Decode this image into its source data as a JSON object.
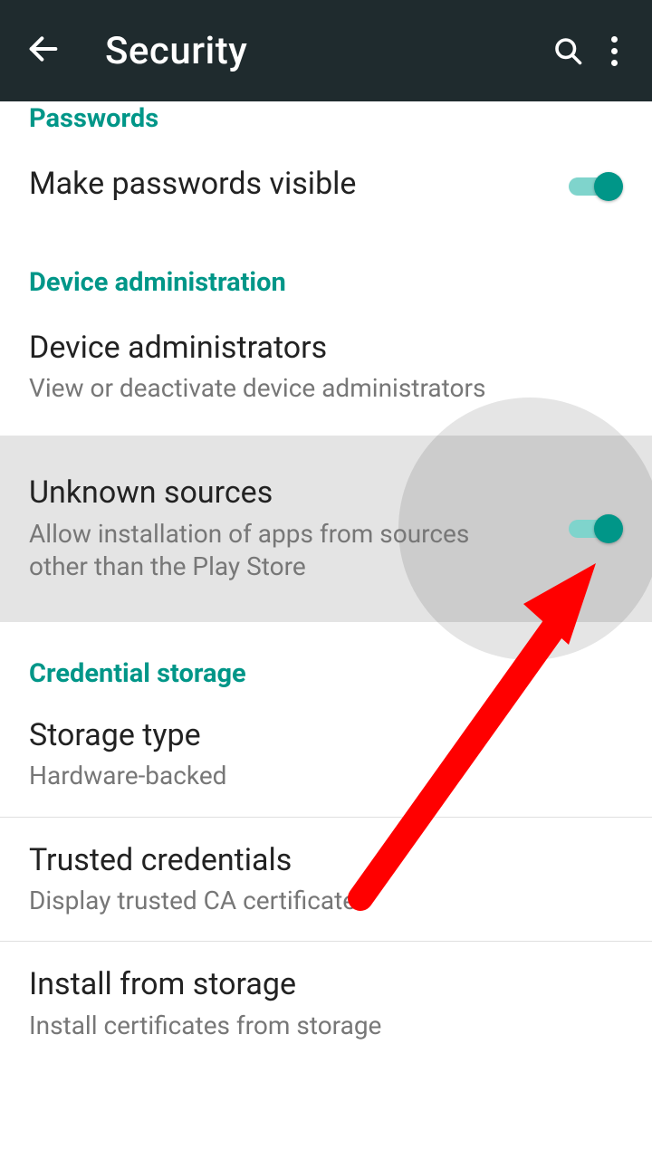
{
  "header": {
    "title": "Security"
  },
  "sections": {
    "passwords_header": "Passwords",
    "make_passwords_visible": "Make passwords visible",
    "device_admin_header": "Device administration",
    "device_administrators_title": "Device administrators",
    "device_administrators_sub": "View or deactivate device administrators",
    "unknown_sources_title": "Unknown sources",
    "unknown_sources_sub": "Allow installation of apps from sources other than the Play Store",
    "credential_storage_header": "Credential storage",
    "storage_type_title": "Storage type",
    "storage_type_sub": "Hardware-backed",
    "trusted_credentials_title": "Trusted credentials",
    "trusted_credentials_sub": "Display trusted CA certificates",
    "install_from_storage_title": "Install from storage",
    "install_from_storage_sub": "Install certificates from storage"
  },
  "toggles": {
    "make_passwords_visible": true,
    "unknown_sources": true
  },
  "colors": {
    "accent": "#009688",
    "appbar": "#1f2b2e",
    "annotation": "#ff0000"
  }
}
